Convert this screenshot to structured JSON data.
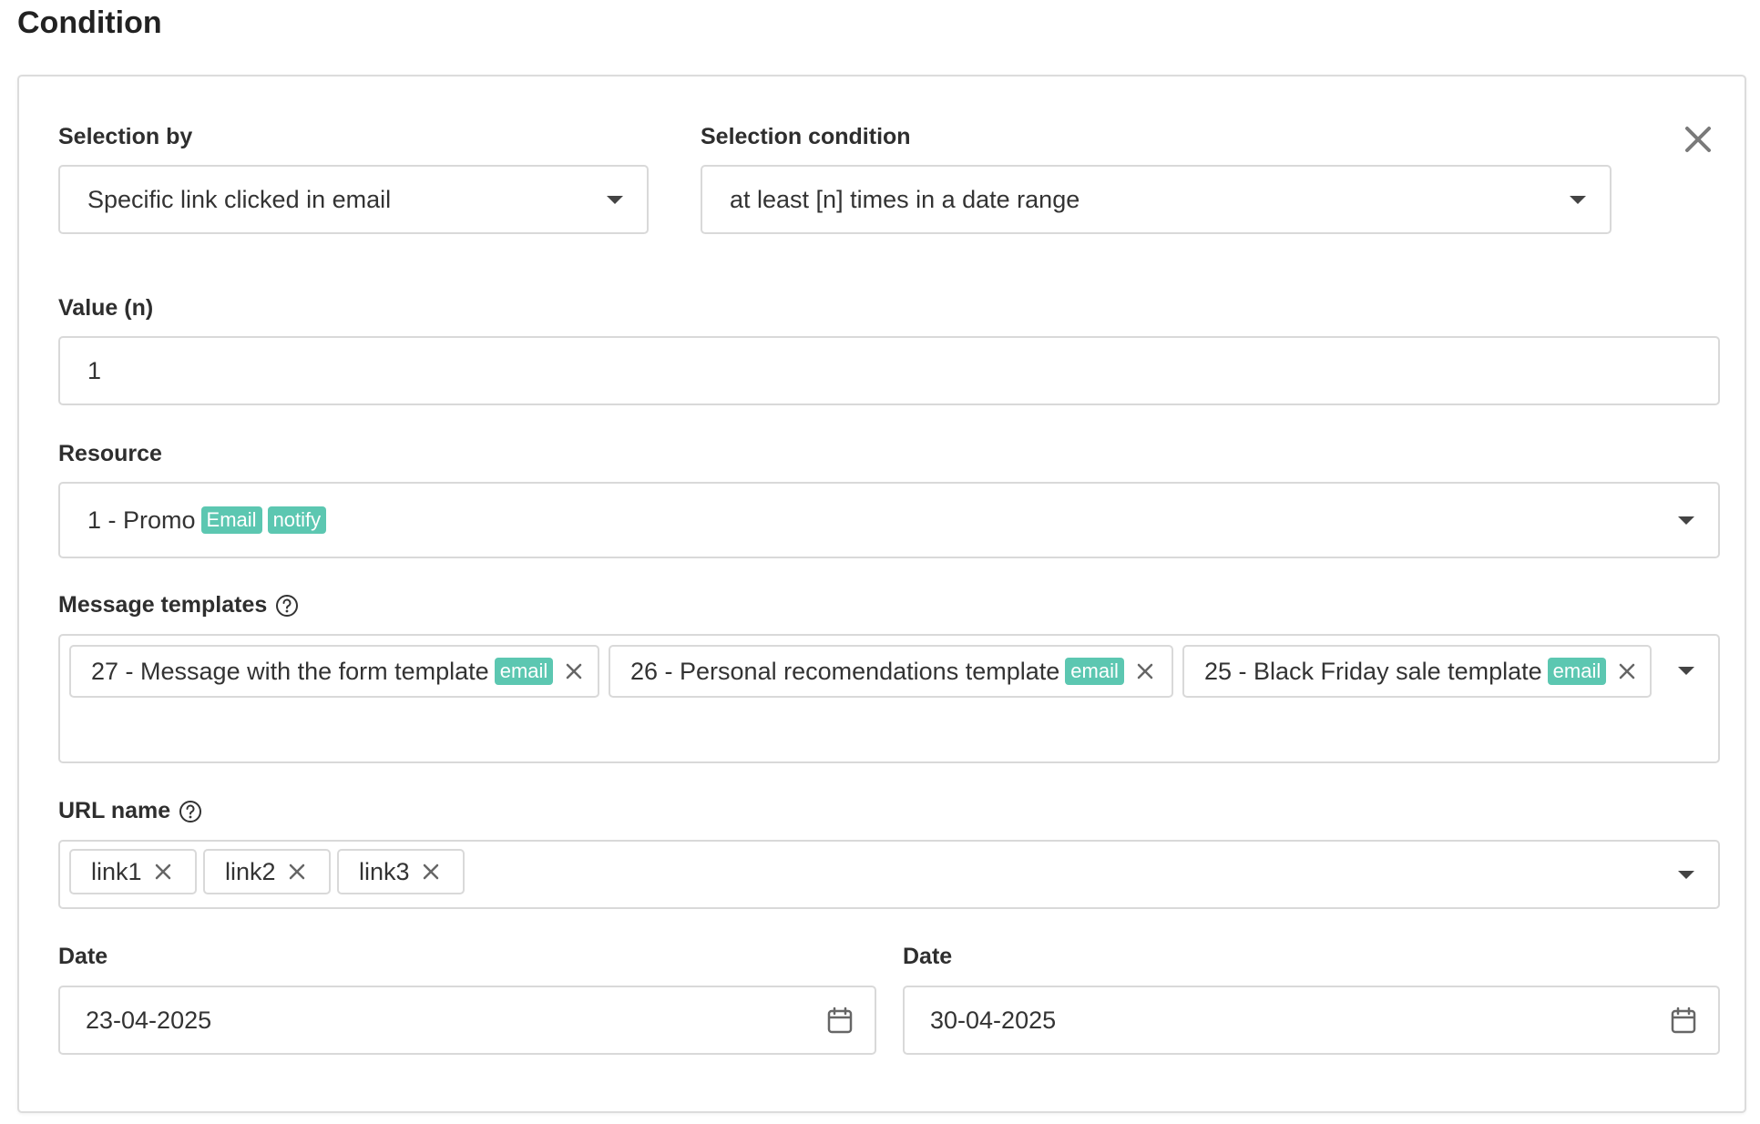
{
  "page": {
    "title": "Condition"
  },
  "selection_by": {
    "label": "Selection by",
    "value": "Specific link clicked in email"
  },
  "selection_condition": {
    "label": "Selection condition",
    "value": "at least [n] times in a date range"
  },
  "value_n": {
    "label": "Value (n)",
    "value": "1"
  },
  "resource": {
    "label": "Resource",
    "value": "1 - Promo",
    "badges": [
      "Email",
      "notify"
    ]
  },
  "message_templates": {
    "label": "Message templates",
    "items": [
      {
        "text": "27 - Message with the form template",
        "badge": "email"
      },
      {
        "text": "26 - Personal recomendations template",
        "badge": "email"
      },
      {
        "text": "25 - Black Friday sale template",
        "badge": "email"
      }
    ]
  },
  "url_name": {
    "label": "URL name",
    "items": [
      "link1",
      "link2",
      "link3"
    ]
  },
  "date_from": {
    "label": "Date",
    "value": "23-04-2025"
  },
  "date_to": {
    "label": "Date",
    "value": "30-04-2025"
  },
  "colors": {
    "badge": "#5cc7b1",
    "border": "#d9d9d9"
  },
  "icons": {
    "close": "close-icon",
    "help": "question-circle-icon",
    "calendar": "calendar-icon",
    "caret": "chevron-down-icon",
    "remove": "x-icon"
  }
}
